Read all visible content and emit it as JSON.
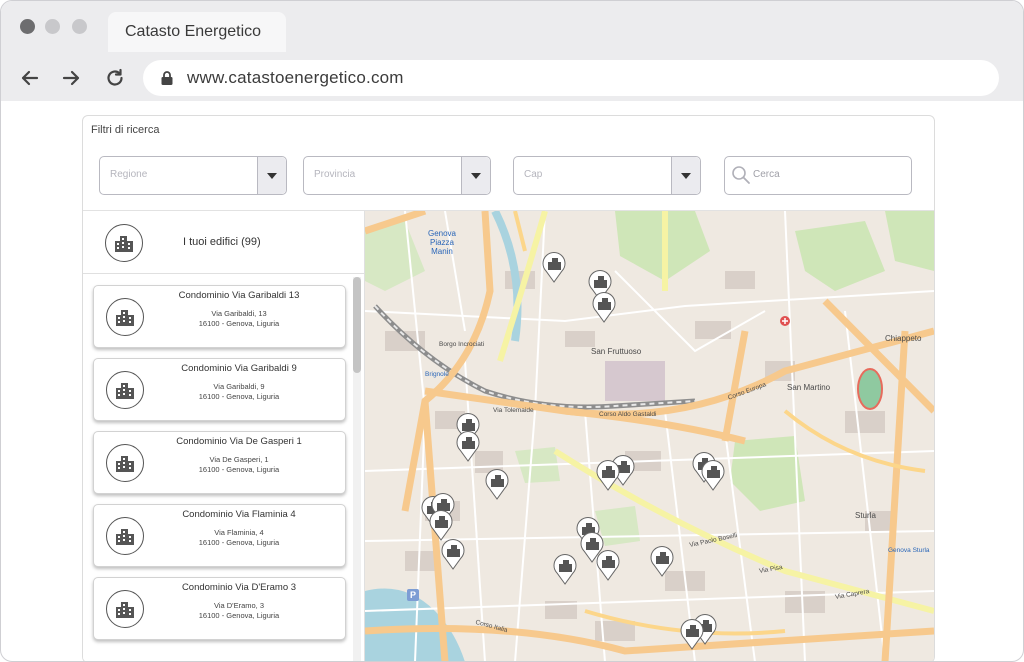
{
  "browser": {
    "tab_title": "Catasto Energetico",
    "url": "www.catastoenergetico.com",
    "traffic_colors": [
      "#6d6d6f",
      "#c8c8cb",
      "#c8c8cb"
    ]
  },
  "filters": {
    "title": "Filtri di ricerca",
    "region_placeholder": "Regione",
    "province_placeholder": "Provincia",
    "cap_placeholder": "Cap",
    "search_placeholder": "Cerca"
  },
  "sidebar": {
    "header": "I tuoi edifici (99)",
    "buildings": [
      {
        "name": "Condominio Via Garibaldi 13",
        "street": "Via Garibaldi, 13",
        "city": "16100 - Genova, Liguria"
      },
      {
        "name": "Condominio Via Garibaldi 9",
        "street": "Via Garibaldi, 9",
        "city": "16100 - Genova, Liguria"
      },
      {
        "name": "Condominio Via De Gasperi 1",
        "street": "Via De Gasperi, 1",
        "city": "16100 - Genova, Liguria"
      },
      {
        "name": "Condominio Via Flaminia 4",
        "street": "Via Flaminia, 4",
        "city": "16100 - Genova, Liguria"
      },
      {
        "name": "Condominio Via D'Eramo 3",
        "street": "Via D'Eramo, 3",
        "city": "16100 - Genova, Liguria"
      }
    ]
  },
  "map": {
    "labels": {
      "piazza_manin": "Genova Piazza Manin",
      "san_fruttuoso": "San Fruttuoso",
      "san_martino": "San Martino",
      "corso_europa": "Corso Europa",
      "corso_gastaldi": "Corso Aldo Gastaldi",
      "via_tolemaide": "Via Tolemaide",
      "via_pisa": "Via Pisa",
      "via_caprera": "Via Caprera",
      "via_paolo_boselli": "Via Paolo Boselli",
      "chiappeto": "Chiappeto",
      "brignole": "Brignole",
      "borgo_incrociati": "Borgo Incrociati",
      "sturla": "Sturla",
      "genova_sturla": "Genova Sturla",
      "corso_italia": "Corso Italia",
      "parking": "P"
    },
    "colors": {
      "land": "#efe9e1",
      "major_road": "#f7c98d",
      "primary_road": "#fcd68a",
      "yellow_road": "#f6f3a4",
      "park": "#cfe6b8",
      "sea": "#a9d3df",
      "building": "#d9d0c9",
      "rail": "#8d8d8d",
      "pin": "#555555"
    }
  }
}
